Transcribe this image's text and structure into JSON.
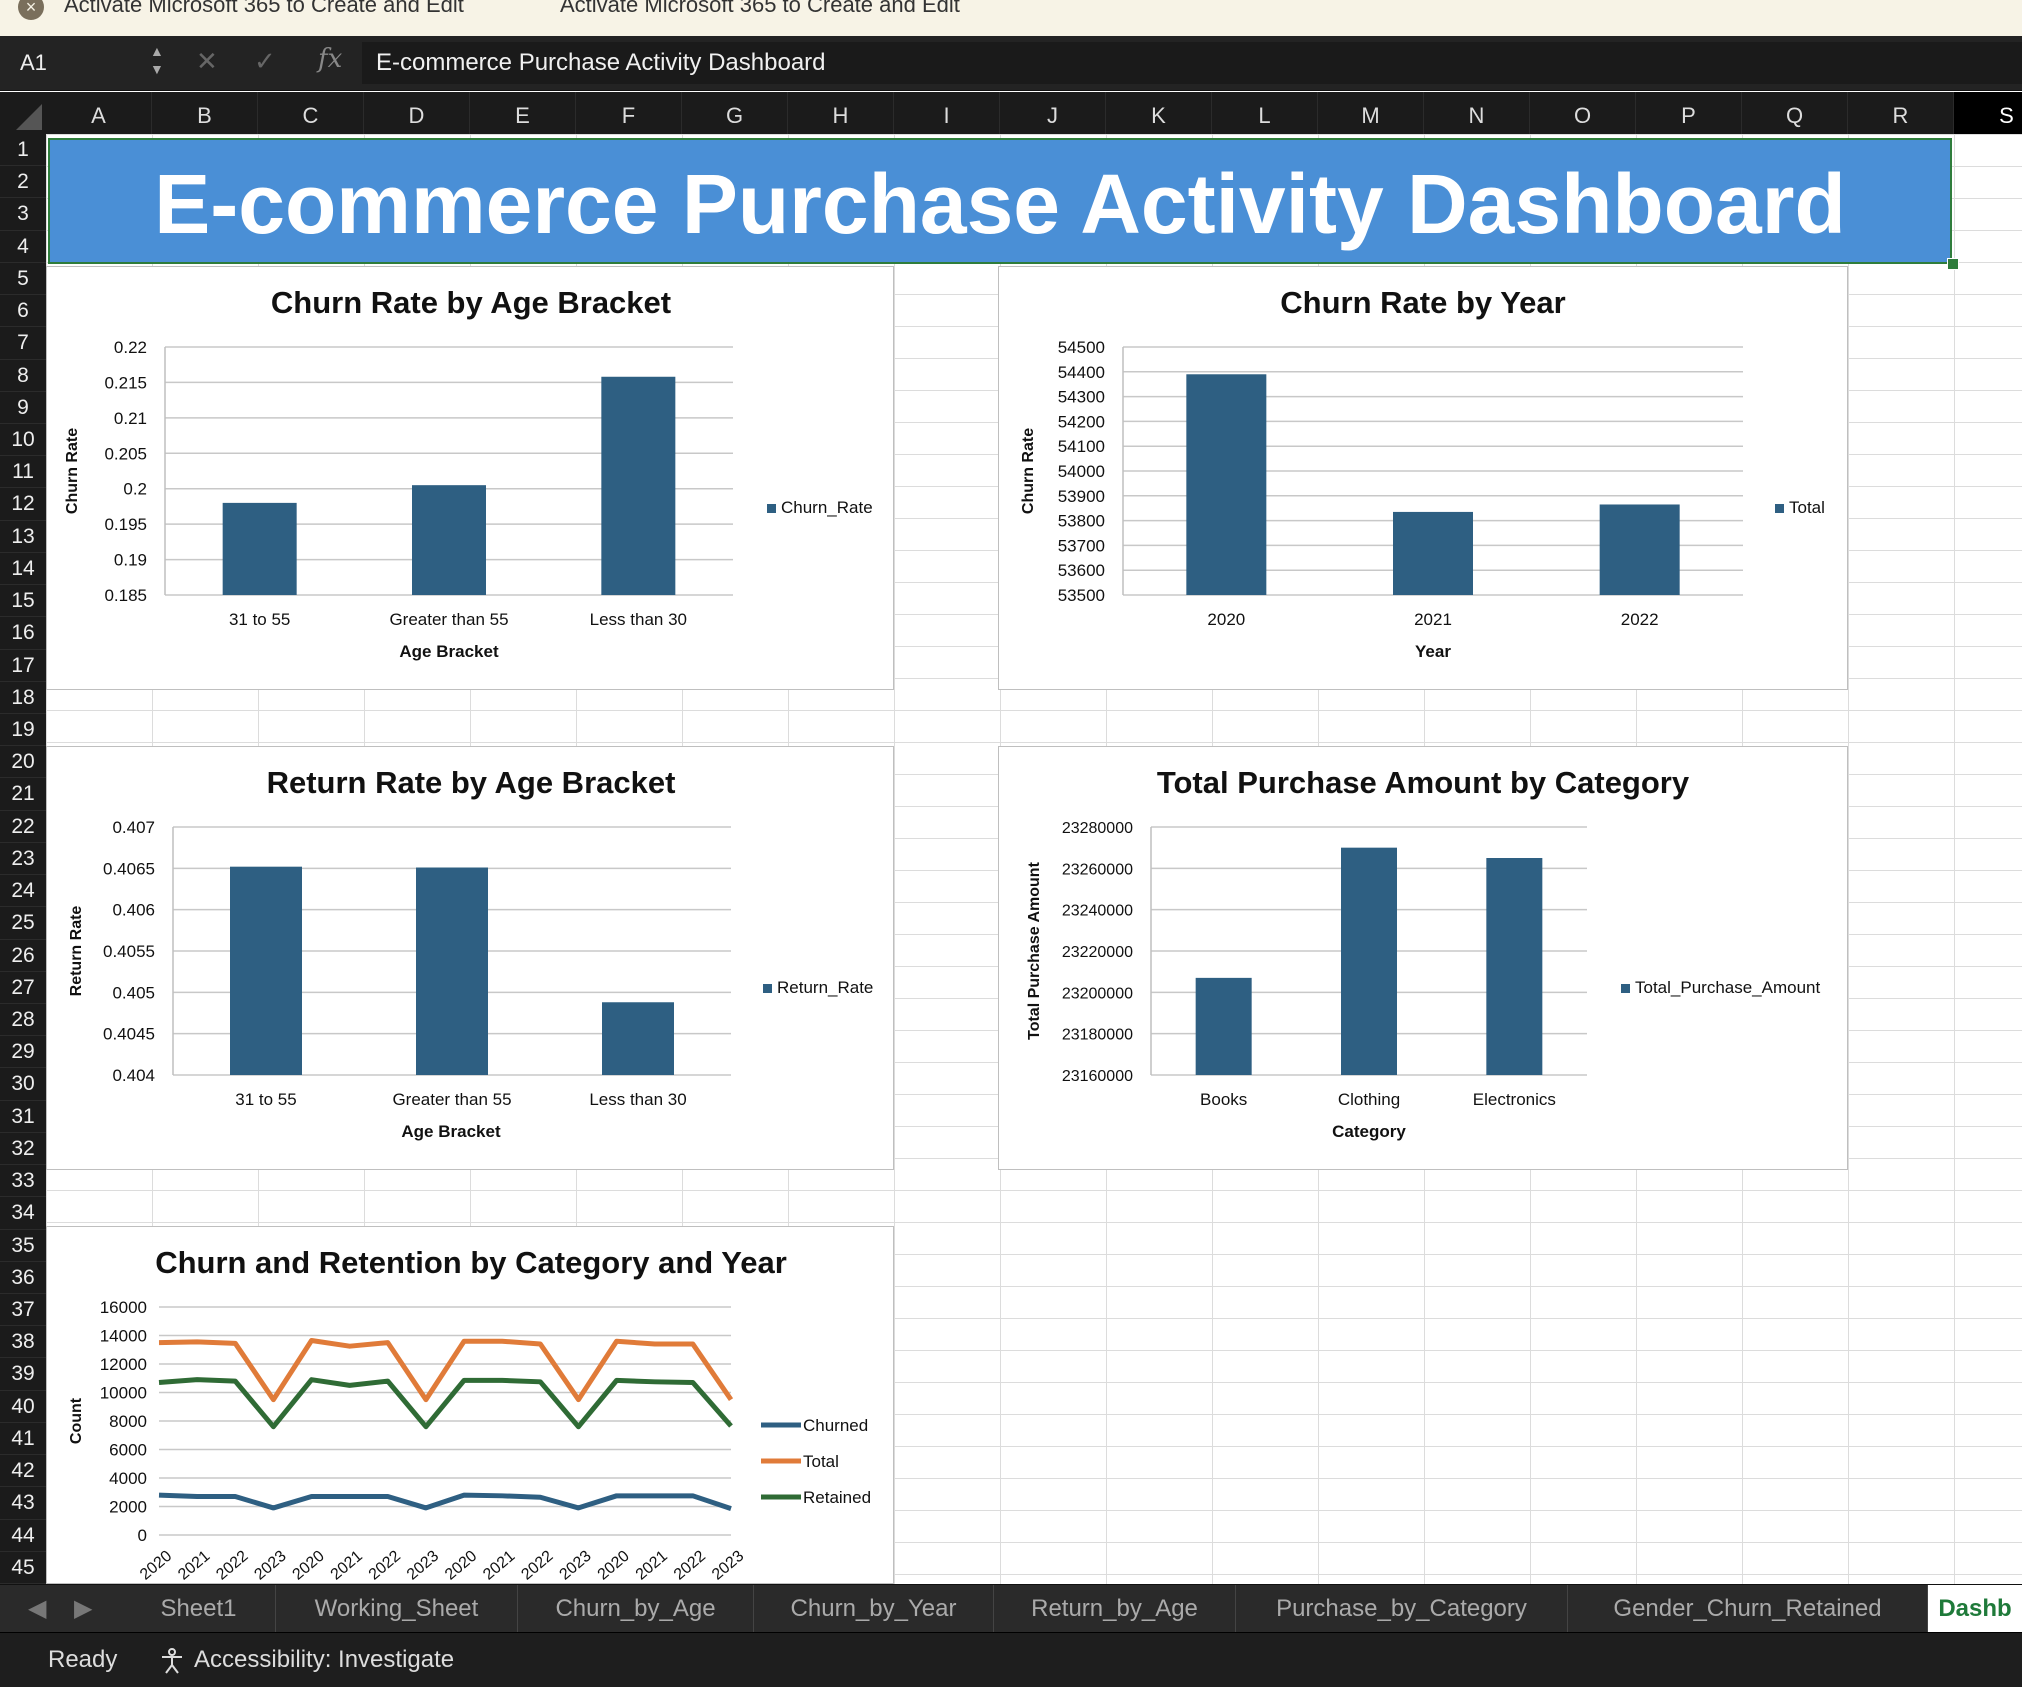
{
  "activation_bar": {
    "message_1": "Activate Microsoft 365 to Create and Edit",
    "message_2": "Activate Microsoft 365 to Create and Edit"
  },
  "formula_bar": {
    "name_box": "A1",
    "fx_label": "fx",
    "formula": "E-commerce Purchase Activity Dashboard"
  },
  "columns": [
    "A",
    "B",
    "C",
    "D",
    "E",
    "F",
    "G",
    "H",
    "I",
    "J",
    "K",
    "L",
    "M",
    "N",
    "O",
    "P",
    "Q",
    "R",
    "S"
  ],
  "rows": [
    "1",
    "2",
    "3",
    "4",
    "5",
    "6",
    "7",
    "8",
    "9",
    "10",
    "11",
    "12",
    "13",
    "14",
    "15",
    "16",
    "17",
    "18",
    "19",
    "20",
    "21",
    "22",
    "23",
    "24",
    "25",
    "26",
    "27",
    "28",
    "29",
    "30",
    "31",
    "32",
    "33",
    "34",
    "35",
    "36",
    "37",
    "38",
    "39",
    "40",
    "41",
    "42",
    "43",
    "44",
    "45"
  ],
  "dashboard": {
    "title": "E-commerce Purchase Activity Dashboard",
    "banner_color": "#4a8fd6"
  },
  "chart_data": [
    {
      "type": "bar",
      "title": "Churn Rate by Age Bracket",
      "xlabel": "Age Bracket",
      "ylabel": "Churn Rate",
      "categories": [
        "31 to 55",
        "Greater than 55",
        "Less than 30"
      ],
      "series": [
        {
          "name": "Churn_Rate",
          "values": [
            0.198,
            0.2005,
            0.2158
          ]
        }
      ],
      "ylim": [
        0.185,
        0.22
      ],
      "yticks": [
        "0.22",
        "0.215",
        "0.21",
        "0.205",
        "0.2",
        "0.195",
        "0.19",
        "0.185"
      ],
      "grid": true,
      "legend": "right",
      "color": "#2e5f82"
    },
    {
      "type": "bar",
      "title": "Churn Rate by Year",
      "xlabel": "Year",
      "ylabel": "Churn Rate",
      "categories": [
        "2020",
        "2021",
        "2022"
      ],
      "series": [
        {
          "name": "Total",
          "values": [
            54390,
            53835,
            53865
          ]
        }
      ],
      "ylim": [
        53500,
        54500
      ],
      "yticks": [
        "54500",
        "54400",
        "54300",
        "54200",
        "54100",
        "54000",
        "53900",
        "53800",
        "53700",
        "53600",
        "53500"
      ],
      "grid": true,
      "legend": "right",
      "color": "#2e5f82"
    },
    {
      "type": "bar",
      "title": "Return Rate by Age Bracket",
      "xlabel": "Age Bracket",
      "ylabel": "Return Rate",
      "categories": [
        "31 to 55",
        "Greater than 55",
        "Less than 30"
      ],
      "series": [
        {
          "name": "Return_Rate",
          "values": [
            0.40652,
            0.40651,
            0.40488
          ]
        }
      ],
      "ylim": [
        0.404,
        0.407
      ],
      "yticks": [
        "0.407",
        "0.4065",
        "0.406",
        "0.4055",
        "0.405",
        "0.4045",
        "0.404"
      ],
      "grid": true,
      "legend": "right",
      "color": "#2e5f82"
    },
    {
      "type": "bar",
      "title": "Total Purchase Amount by Category",
      "xlabel": "Category",
      "ylabel": "Total Purchase Amount",
      "categories": [
        "Books",
        "Clothing",
        "Electronics"
      ],
      "series": [
        {
          "name": "Total_Purchase_Amount",
          "values": [
            23207000,
            23270000,
            23265000
          ]
        }
      ],
      "ylim": [
        23160000,
        23280000
      ],
      "yticks": [
        "23280000",
        "23260000",
        "23240000",
        "23220000",
        "23200000",
        "23180000",
        "23160000"
      ],
      "grid": true,
      "legend": "right",
      "color": "#2e5f82"
    },
    {
      "type": "line",
      "title": "Churn and Retention by Category and Year",
      "xlabel": "",
      "ylabel": "Count",
      "categories": [
        "2020",
        "2021",
        "2022",
        "2023",
        "2020",
        "2021",
        "2022",
        "2023",
        "2020",
        "2021",
        "2022",
        "2023",
        "2020",
        "2021",
        "2022",
        "2023"
      ],
      "series": [
        {
          "name": "Churned",
          "values": [
            2800,
            2700,
            2700,
            1900,
            2700,
            2700,
            2700,
            1900,
            2800,
            2750,
            2650,
            1900,
            2750,
            2750,
            2750,
            1850
          ],
          "color": "#2e5f82"
        },
        {
          "name": "Total",
          "values": [
            13500,
            13550,
            13450,
            9500,
            13650,
            13250,
            13500,
            9500,
            13600,
            13600,
            13400,
            9500,
            13600,
            13400,
            13400,
            9500
          ],
          "color": "#e07b39"
        },
        {
          "name": "Retained",
          "values": [
            10700,
            10900,
            10800,
            7600,
            10900,
            10500,
            10800,
            7600,
            10850,
            10850,
            10750,
            7600,
            10850,
            10750,
            10700,
            7650
          ],
          "color": "#2f6b35"
        }
      ],
      "ylim": [
        0,
        16000
      ],
      "yticks": [
        "16000",
        "14000",
        "12000",
        "10000",
        "8000",
        "6000",
        "4000",
        "2000",
        "0"
      ],
      "grid": true,
      "legend": "right"
    }
  ],
  "sheet_tabs": [
    "Sheet1",
    "Working_Sheet",
    "Churn_by_Age",
    "Churn_by_Year",
    "Return_by_Age",
    "Purchase_by_Category",
    "Gender_Churn_Retained",
    "Dashb"
  ],
  "status_bar": {
    "ready": "Ready",
    "accessibility": "Accessibility: Investigate"
  }
}
